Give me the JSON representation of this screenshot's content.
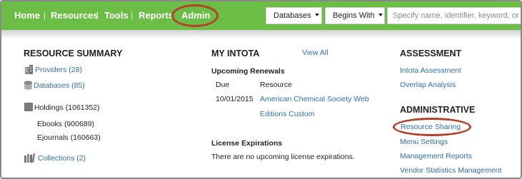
{
  "nav": {
    "home": "Home",
    "resources": "Resources",
    "tools": "Tools",
    "reports": "Reports",
    "admin": "Admin",
    "separator": "|"
  },
  "search": {
    "scope_dropdown": "Databases",
    "match_dropdown": "Begins With",
    "placeholder": "Specify name, identifier, keyword, or UR"
  },
  "resource_summary": {
    "title": "RESOURCE SUMMARY",
    "providers": "Providers (28)",
    "databases": "Databases (85)",
    "holdings": "Holdings (1061352)",
    "ebooks": "Ebooks (900689)",
    "ejournals": "Ejournals (160663)",
    "collections": "Collections (2)"
  },
  "my_intota": {
    "title": "MY INTOTA",
    "view_all": "View All",
    "upcoming_renewals": "Upcoming Renewals",
    "col_due": "Due",
    "col_resource": "Resource",
    "renewal_due": "10/01/2015",
    "renewal_resource_line1": "American Chemical Society Web",
    "renewal_resource_line2": "Editions Custom",
    "license_expirations": "License Expirations",
    "license_message": "There are no upcoming license expirations."
  },
  "assessment": {
    "title": "ASSESSMENT",
    "intota_assessment": "Intota Assessment",
    "overlap_analysis": "Overlap Analysis"
  },
  "administrative": {
    "title": "ADMINISTRATIVE",
    "resource_sharing": "Resource Sharing",
    "menu_settings": "Menu Settings",
    "management_reports": "Management Reports",
    "vendor_statistics": "Vendor Statistics Management"
  },
  "colors": {
    "nav_bar": "#6cbd45",
    "link": "#2f6fad",
    "highlight_oval": "#b4402d"
  },
  "icons": [
    "building-icon",
    "database-icon",
    "holdings-icon",
    "collections-icon"
  ]
}
